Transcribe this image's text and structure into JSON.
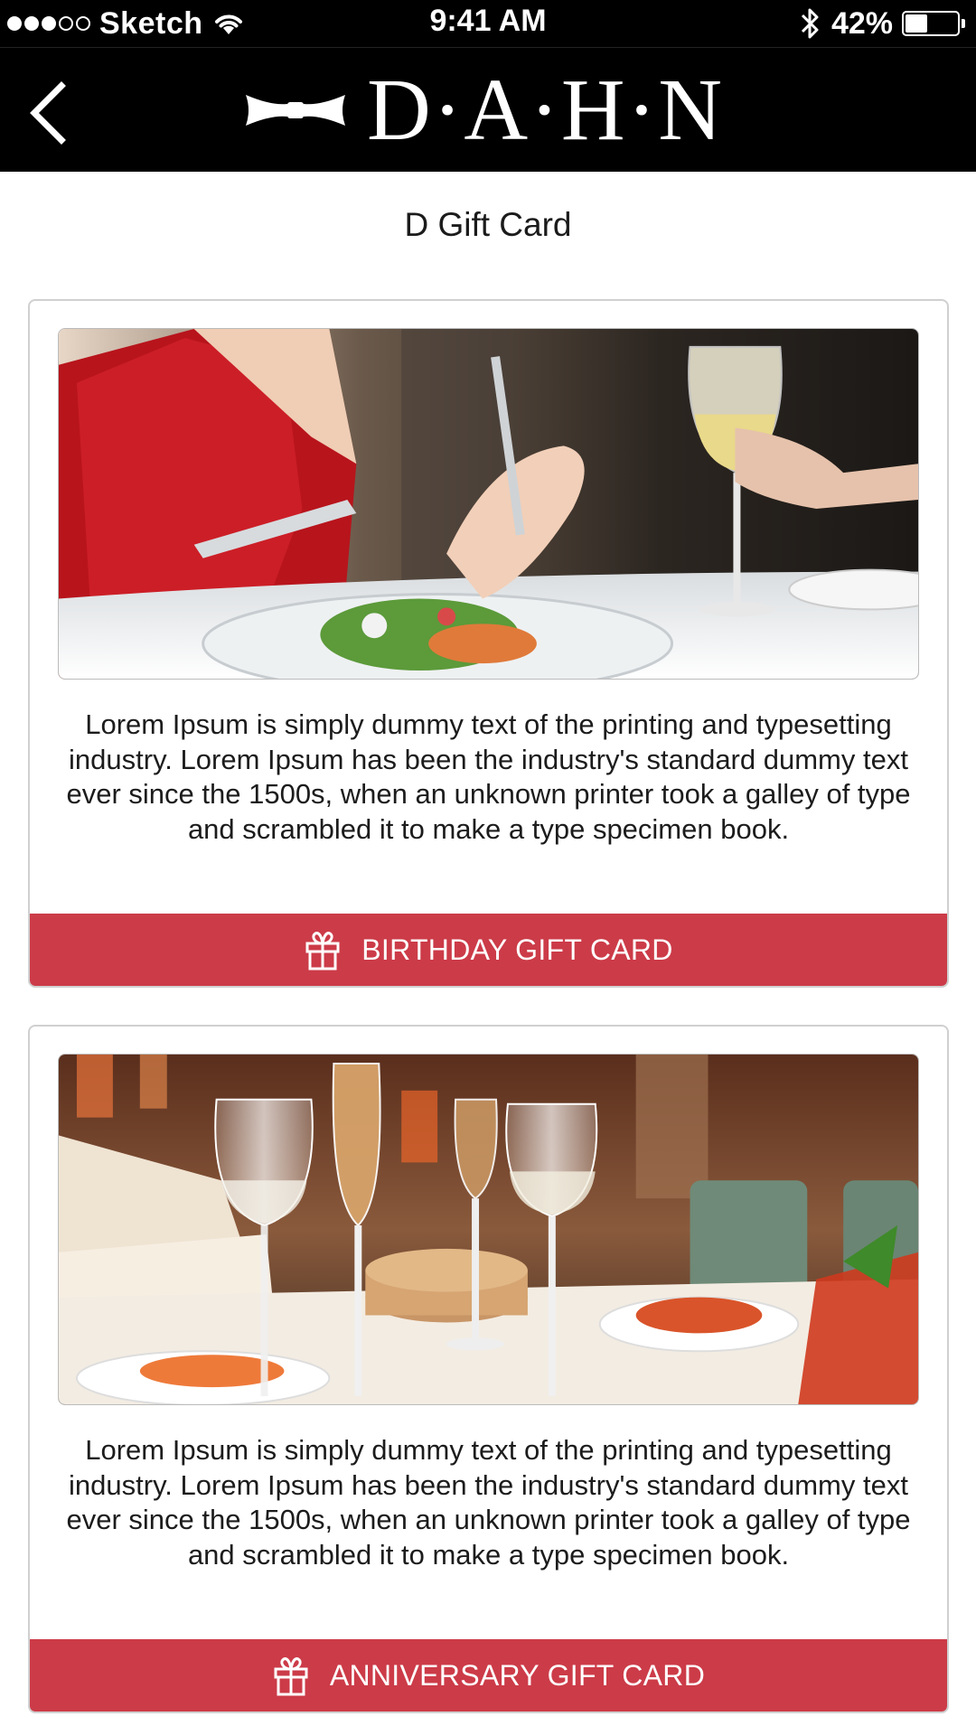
{
  "status_bar": {
    "carrier": "Sketch",
    "time": "9:41 AM",
    "battery_percent": "42%",
    "battery_level": 0.42,
    "signal_bars_filled": 3,
    "signal_bars_total": 5
  },
  "nav": {
    "brand": "D·A·H·N",
    "back_icon": "chevron-left-icon",
    "logo_icon": "bowtie-icon"
  },
  "page": {
    "title": "D Gift Card"
  },
  "cards": [
    {
      "image": "fine-dining-couple-photo",
      "description": "Lorem Ipsum is simply dummy text of the printing and typesetting industry. Lorem Ipsum has been the industry's standard dummy text ever since the 1500s, when an unknown printer took a galley of type and scrambled it to make a type specimen book.",
      "button_label": "BIRTHDAY GIFT CARD",
      "button_icon": "gift-icon"
    },
    {
      "image": "restaurant-wine-glasses-photo",
      "description": "Lorem Ipsum is simply dummy text of the printing and typesetting industry. Lorem Ipsum has been the industry's standard dummy text ever since the 1500s, when an unknown printer took a galley of type and scrambled it to make a type specimen book.",
      "button_label": "ANNIVERSARY GIFT CARD",
      "button_icon": "gift-icon"
    }
  ],
  "colors": {
    "bar_background": "#000000",
    "button_accent": "#cc3b48",
    "card_border": "#d0d0d0"
  }
}
